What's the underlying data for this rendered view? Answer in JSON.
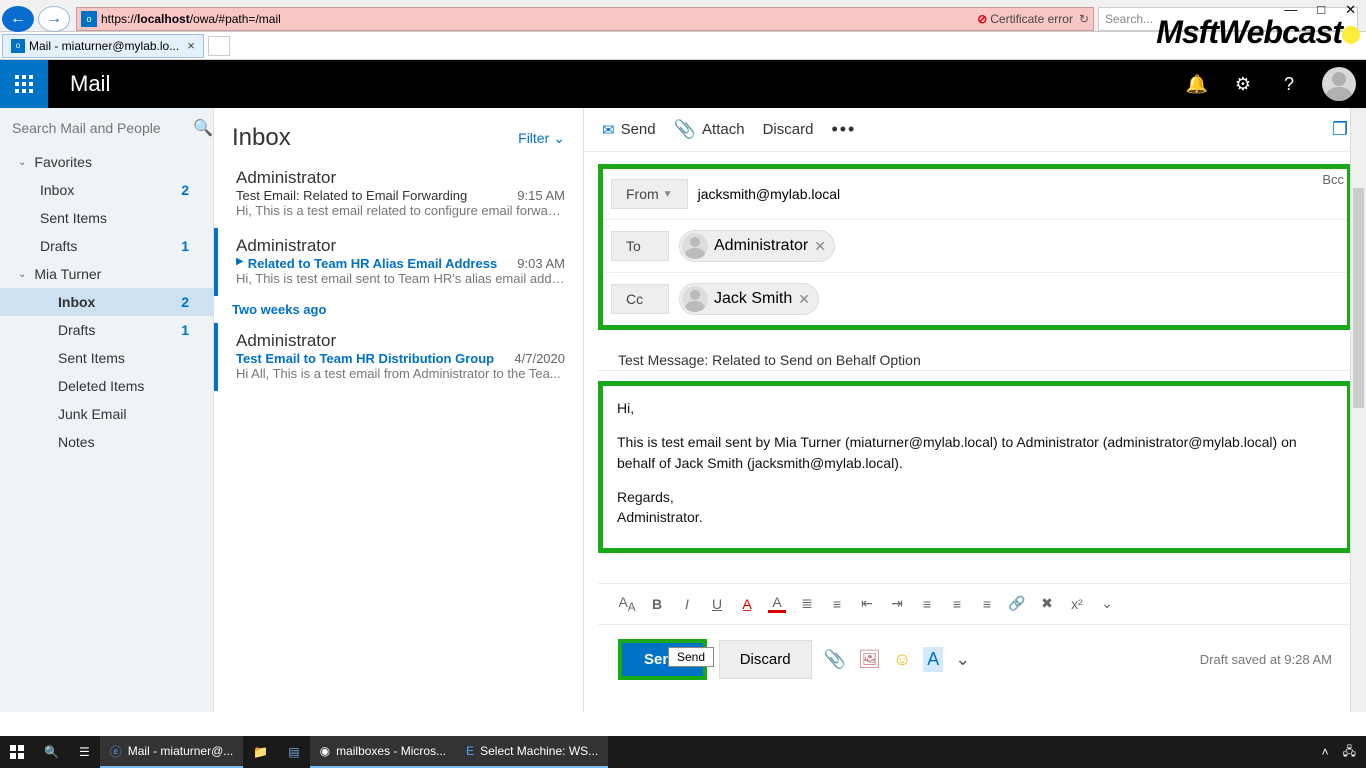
{
  "window": {
    "minimize": "—",
    "maximize": "□",
    "close": "✕"
  },
  "browser": {
    "url_prefix": "https://",
    "url_host": "localhost",
    "url_path": "/owa/#path=/mail",
    "cert_error": "Certificate error",
    "search_placeholder": "Search..."
  },
  "watermark": "MsftWebcast",
  "tab": {
    "title": "Mail - miaturner@mylab.lo..."
  },
  "header": {
    "app": "Mail"
  },
  "search": {
    "placeholder": "Search Mail and People"
  },
  "sidebar": {
    "favorites": "Favorites",
    "fav_items": [
      {
        "label": "Inbox",
        "count": "2"
      },
      {
        "label": "Sent Items",
        "count": ""
      },
      {
        "label": "Drafts",
        "count": "1"
      }
    ],
    "account": "Mia Turner",
    "acc_items": [
      {
        "label": "Inbox",
        "count": "2",
        "selected": true
      },
      {
        "label": "Drafts",
        "count": "1"
      },
      {
        "label": "Sent Items",
        "count": ""
      },
      {
        "label": "Deleted Items",
        "count": ""
      },
      {
        "label": "Junk Email",
        "count": ""
      },
      {
        "label": "Notes",
        "count": ""
      }
    ]
  },
  "inbox": {
    "title": "Inbox",
    "filter": "Filter",
    "messages": [
      {
        "from": "Administrator",
        "subject": "Test Email: Related to Email Forwarding",
        "time": "9:15 AM",
        "preview": "Hi, This is a test email related to configure email forward..."
      },
      {
        "from": "Administrator",
        "subject": "Related to Team HR Alias Email Address",
        "time": "9:03 AM",
        "preview": "Hi, This is test email sent to Team HR's alias email addre...",
        "selected": true
      }
    ],
    "divider": "Two weeks ago",
    "older": [
      {
        "from": "Administrator",
        "subject": "Test Email to Team HR Distribution Group",
        "time": "4/7/2020",
        "preview": "Hi All, This is a test email from Administrator to the Tea..."
      }
    ]
  },
  "compose": {
    "toolbar": {
      "send": "Send",
      "attach": "Attach",
      "discard": "Discard"
    },
    "bcc": "Bcc",
    "from_label": "From",
    "from_value": "jacksmith@mylab.local",
    "to_label": "To",
    "to_recipient": "Administrator",
    "cc_label": "Cc",
    "cc_recipient": "Jack Smith",
    "subject": "Test Message: Related to Send on Behalf Option",
    "body": {
      "greeting": "Hi,",
      "para": "This is test email sent by Mia Turner (miaturner@mylab.local) to Administrator (administrator@mylab.local) on behalf of Jack Smith (jacksmith@mylab.local).",
      "reg1": "Regards,",
      "reg2": "Administrator."
    },
    "tooltip": "Send",
    "send_btn": "Send",
    "discard_btn": "Discard",
    "draft_saved": "Draft saved at 9:28 AM"
  },
  "taskbar": {
    "ie": "Mail - miaturner@...",
    "chrome": "mailboxes - Micros...",
    "exch": "Select Machine: WS..."
  }
}
